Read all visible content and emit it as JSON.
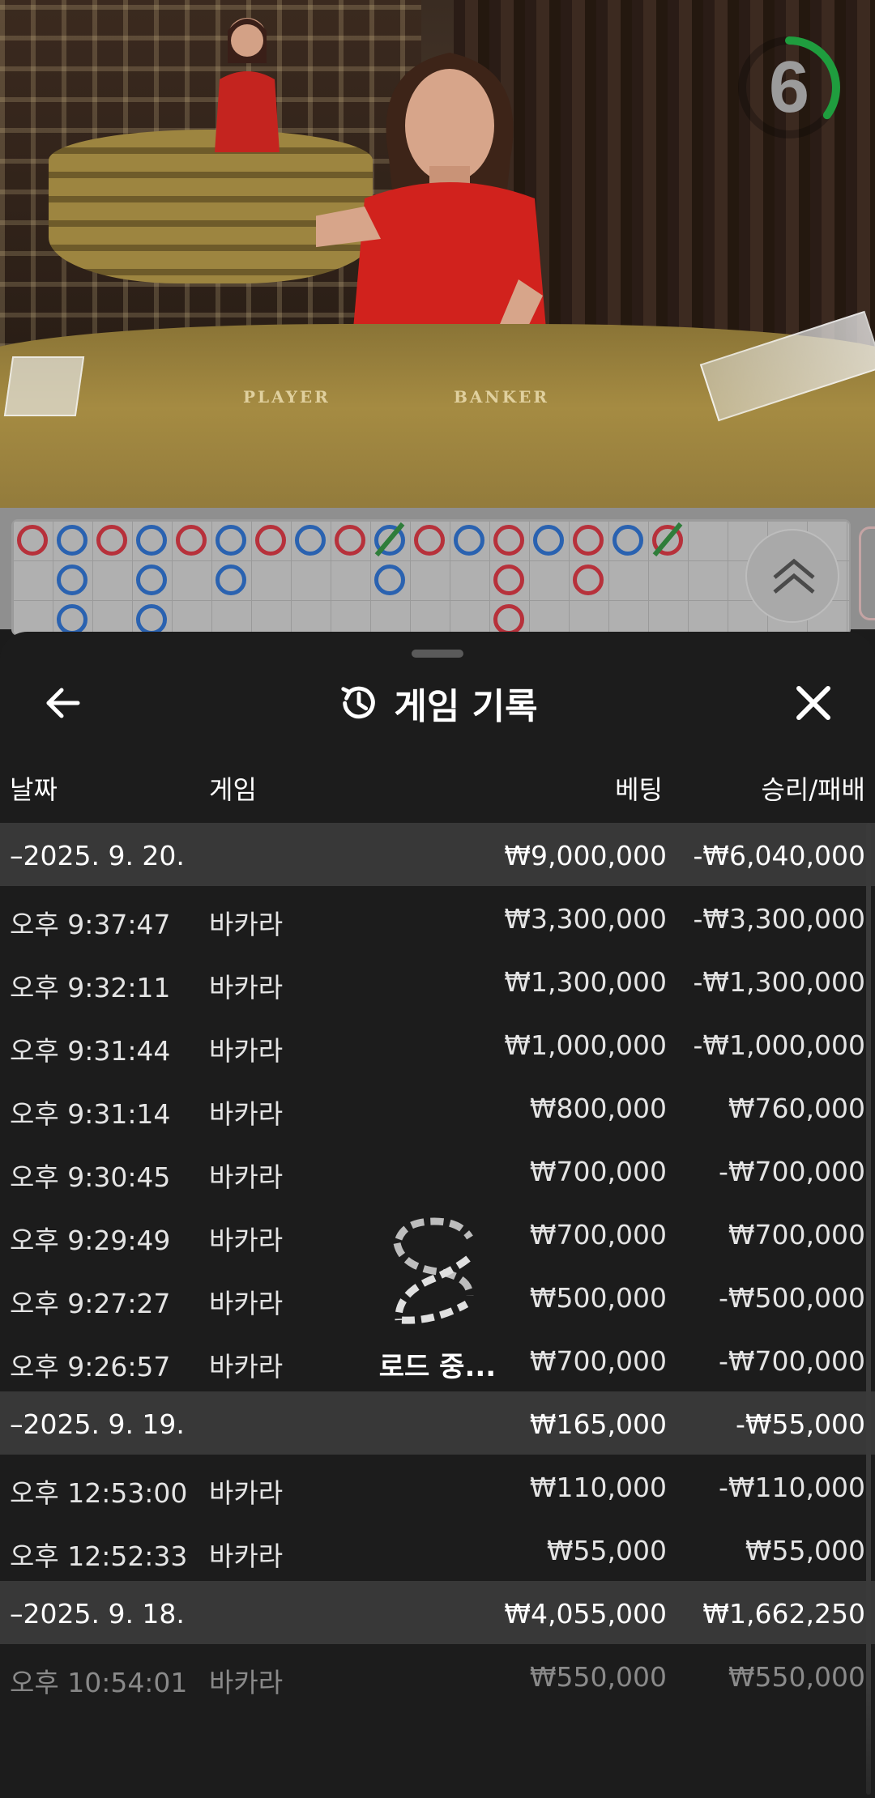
{
  "video": {
    "felt_player": "PLAYER",
    "felt_banker": "BANKER",
    "timer_value": "6",
    "timer_fraction": 0.35,
    "timer_color": "#1f9d3e"
  },
  "roadmap": {
    "top_row": [
      "red",
      "blue",
      "red",
      "blue",
      "red",
      "blue",
      "red",
      "blue",
      "red",
      "blue",
      "red",
      "blue",
      "red",
      "blue",
      "red",
      "blue",
      "red"
    ],
    "column2": [
      "blue",
      "blue",
      "blue",
      "blue",
      "red",
      "red"
    ],
    "colors": {
      "red": "#b7313b",
      "blue": "#2a62b0",
      "tie": "#2f7d3a"
    }
  },
  "sheet": {
    "title": "게임 기록",
    "loading_text": "로드 중...",
    "headers": {
      "date": "날짜",
      "game": "게임",
      "bet": "베팅",
      "winloss": "승리/패배"
    },
    "rows": [
      {
        "type": "group",
        "date": "–2025. 9. 20.",
        "game": "",
        "bet": "₩9,000,000",
        "winloss": "-₩6,040,000"
      },
      {
        "type": "item",
        "date": "오후 9:37:47",
        "game": "바카라",
        "bet": "₩3,300,000",
        "winloss": "-₩3,300,000"
      },
      {
        "type": "item",
        "date": "오후 9:32:11",
        "game": "바카라",
        "bet": "₩1,300,000",
        "winloss": "-₩1,300,000"
      },
      {
        "type": "item",
        "date": "오후 9:31:44",
        "game": "바카라",
        "bet": "₩1,000,000",
        "winloss": "-₩1,000,000"
      },
      {
        "type": "item",
        "date": "오후 9:31:14",
        "game": "바카라",
        "bet": "₩800,000",
        "winloss": "₩760,000"
      },
      {
        "type": "item",
        "date": "오후 9:30:45",
        "game": "바카라",
        "bet": "₩700,000",
        "winloss": "-₩700,000"
      },
      {
        "type": "item",
        "date": "오후 9:29:49",
        "game": "바카라",
        "bet": "₩700,000",
        "winloss": "₩700,000"
      },
      {
        "type": "item",
        "date": "오후 9:27:27",
        "game": "바카라",
        "bet": "₩500,000",
        "winloss": "-₩500,000"
      },
      {
        "type": "item",
        "date": "오후 9:26:57",
        "game": "바카라",
        "bet": "₩700,000",
        "winloss": "-₩700,000"
      },
      {
        "type": "group",
        "date": "–2025. 9. 19.",
        "game": "",
        "bet": "₩165,000",
        "winloss": "-₩55,000"
      },
      {
        "type": "item",
        "date": "오후 12:53:00",
        "game": "바카라",
        "bet": "₩110,000",
        "winloss": "-₩110,000"
      },
      {
        "type": "item",
        "date": "오후 12:52:33",
        "game": "바카라",
        "bet": "₩55,000",
        "winloss": "₩55,000"
      },
      {
        "type": "group",
        "date": "–2025. 9. 18.",
        "game": "",
        "bet": "₩4,055,000",
        "winloss": "₩1,662,250"
      },
      {
        "type": "item dim",
        "date": "오후 10:54:01",
        "game": "바카라",
        "bet": "₩550,000",
        "winloss": "₩550,000"
      }
    ]
  }
}
